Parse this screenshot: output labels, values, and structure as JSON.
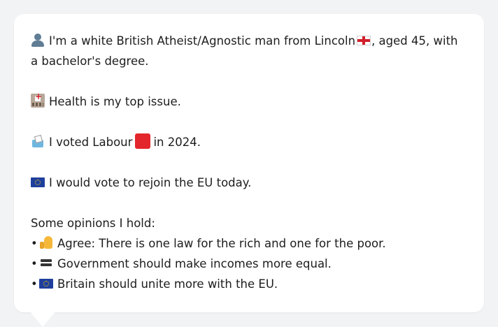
{
  "profile": {
    "intro_pre": "I'm a white British Atheist/Agnostic man from Lincoln",
    "intro_post": ", aged 45, with a bachelor's degree.",
    "health_text": "Health is my top issue.",
    "vote_pre": "I voted Labour",
    "vote_post": "in 2024.",
    "eu_text": "I would vote to rejoin the EU today."
  },
  "opinions": {
    "title": "Some opinions I hold:",
    "items": [
      {
        "icon": "thumbs-up-icon",
        "text": "Agree: There is one law for the rich and one for the poor."
      },
      {
        "icon": "equals-icon",
        "text": "Government should make incomes more equal."
      },
      {
        "icon": "eu-flag-icon",
        "text": "Britain should unite more with the EU."
      }
    ]
  },
  "colors": {
    "background": "#f2f3f5",
    "card": "#ffffff",
    "labour_red": "#e3262c",
    "eu_blue": "#1f3f9c"
  }
}
